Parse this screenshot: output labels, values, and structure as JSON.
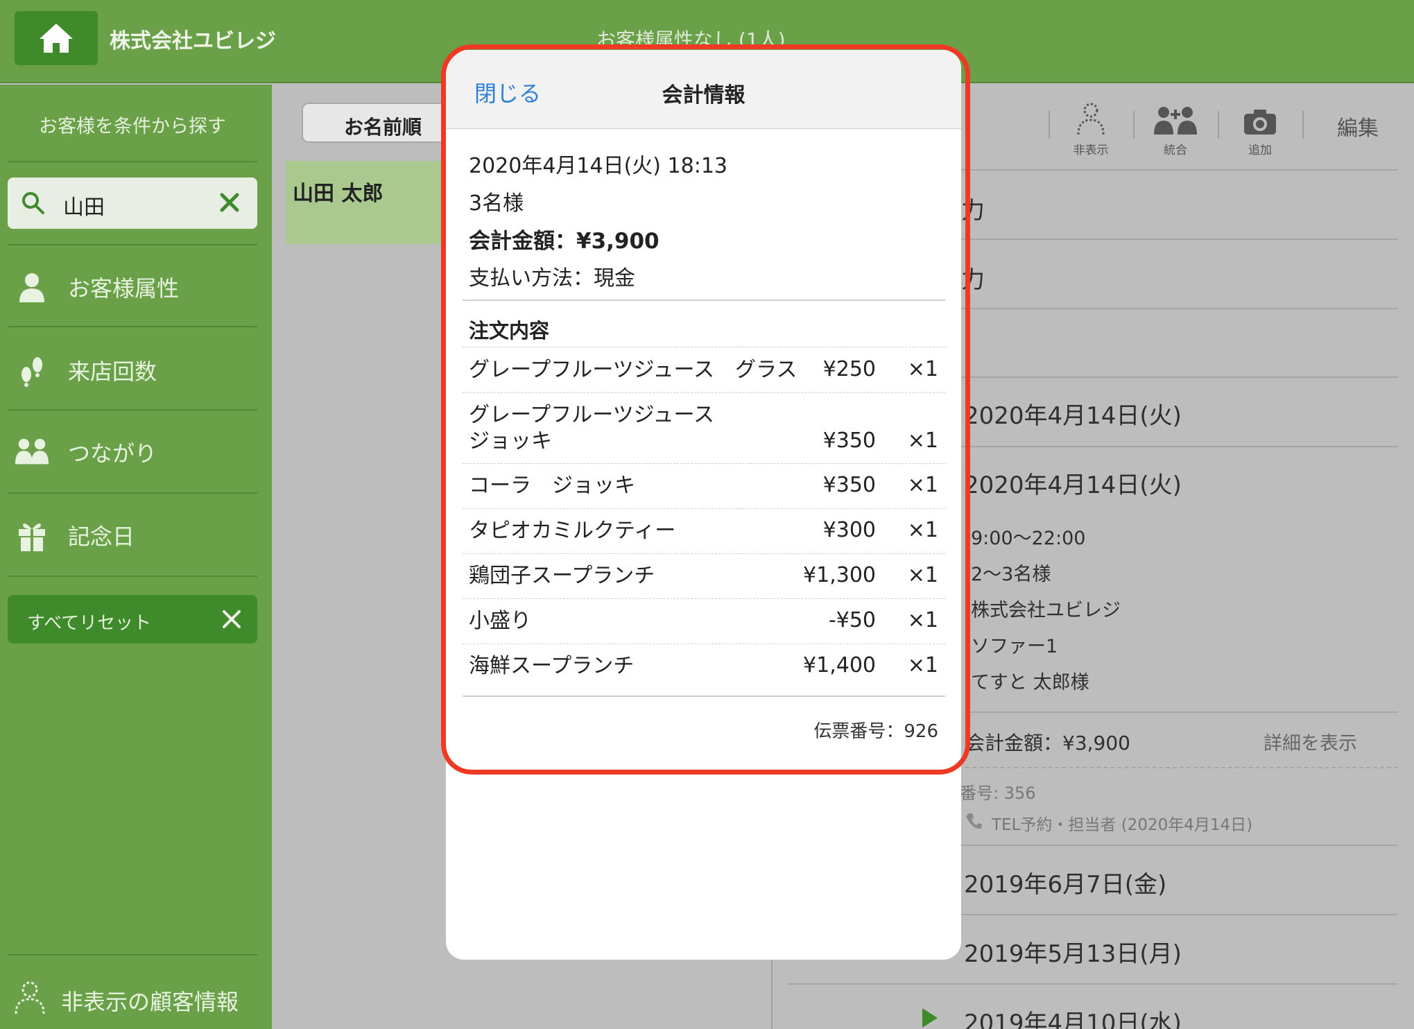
{
  "header": {
    "company": "株式会社ユビレジ",
    "title": "お客様属性なし (1人)"
  },
  "sidebar": {
    "caption": "お客様を条件から探す",
    "search_value": "山田",
    "items": [
      {
        "label": "お客様属性",
        "icon": "person-icon"
      },
      {
        "label": "来店回数",
        "icon": "footprints-icon"
      },
      {
        "label": "つながり",
        "icon": "people-icon"
      },
      {
        "label": "記念日",
        "icon": "gift-icon"
      }
    ],
    "reset_label": "すべてリセット",
    "hidden_label": "非表示の顧客情報"
  },
  "middle": {
    "sort_label": "お名前順",
    "customer_name": "山田 太郎"
  },
  "right": {
    "toolbar": [
      {
        "label": "非表示",
        "icon": "hide-person-icon"
      },
      {
        "label": "統合",
        "icon": "merge-icon"
      },
      {
        "label": "追加",
        "icon": "camera-icon"
      }
    ],
    "edit_label": "編集",
    "row1": "力",
    "row2": "力",
    "date1": "2020年4月14日(火)",
    "date2": "2020年4月14日(火)",
    "time": "9:00〜22:00",
    "guests": "2〜3名様",
    "company": "株式会社ユビレジ",
    "seat": "ソファー1",
    "person": "てすと 太郎様",
    "total": "会計金額：¥3,900",
    "detail_link": "詳細を表示",
    "number": "番号: 356",
    "tel": "TEL予約・担当者 (2020年4月14日)",
    "date3": "2019年6月7日(金)",
    "date4": "2019年5月13日(月)",
    "date5": "2019年4月10日(水)"
  },
  "popup": {
    "close_label": "閉じる",
    "title": "会計情報",
    "datetime": "2020年4月14日(火) 18:13",
    "guests": "3名様",
    "total": "会計金額：¥3,900",
    "payment": "支払い方法：現金",
    "order_heading": "注文内容",
    "orders": [
      {
        "name": "グレープフルーツジュース　グラス",
        "price": "¥250",
        "qty": "×1"
      },
      {
        "name": "グレープフルーツジュース\nジョッキ",
        "price": "¥350",
        "qty": "×1"
      },
      {
        "name": "コーラ　ジョッキ",
        "price": "¥350",
        "qty": "×1"
      },
      {
        "name": "タピオカミルクティー",
        "price": "¥300",
        "qty": "×1"
      },
      {
        "name": "鶏団子スープランチ",
        "price": "¥1,300",
        "qty": "×1"
      },
      {
        "name": "小盛り",
        "price": "-¥50",
        "qty": "×1"
      },
      {
        "name": "海鮮スープランチ",
        "price": "¥1,400",
        "qty": "×1"
      }
    ],
    "slip_number": "伝票番号：926"
  },
  "colors": {
    "header_green": "#6aa148",
    "dark_green": "#3f8a2a",
    "popup_highlight": "#ee3a24",
    "link_blue": "#2e7fd6"
  }
}
